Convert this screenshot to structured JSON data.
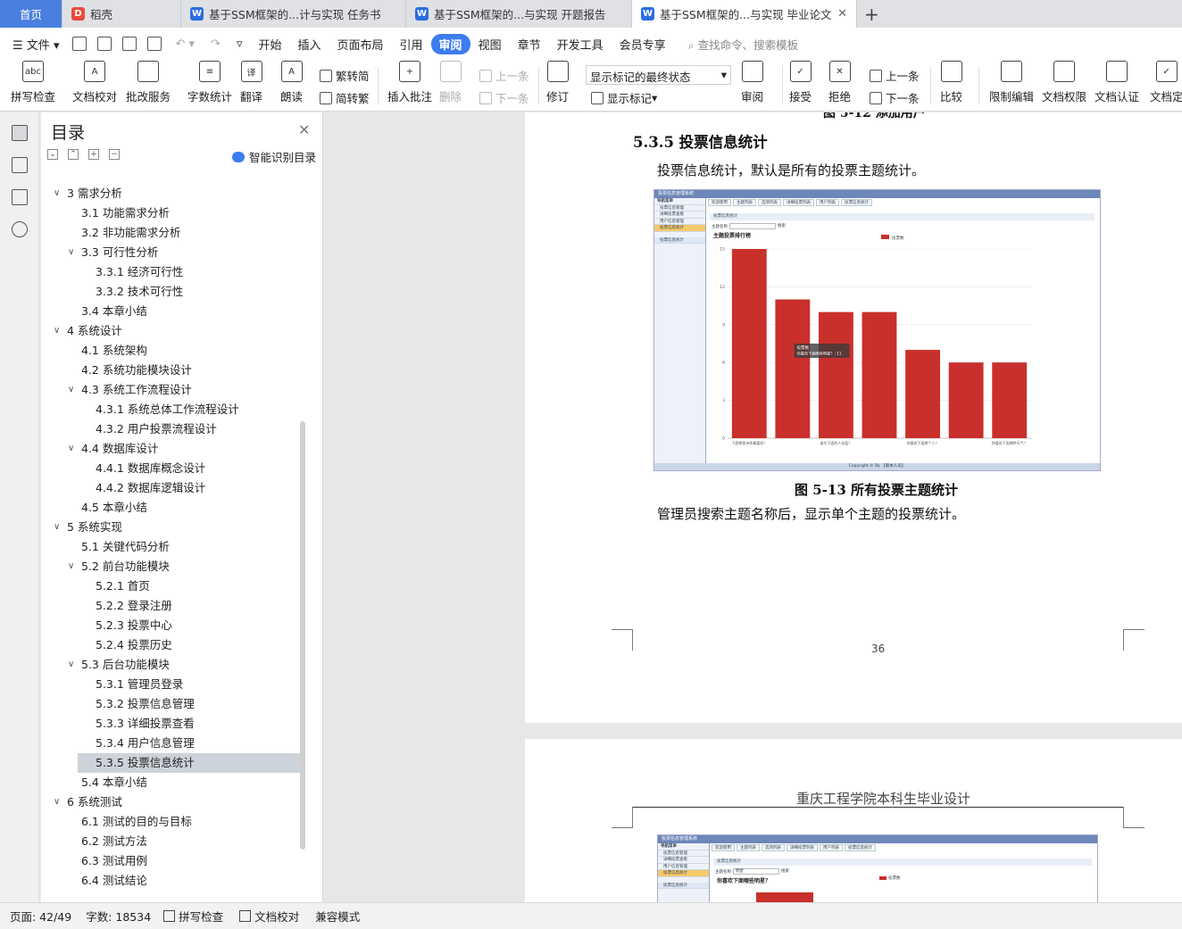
{
  "tabs": {
    "home": "首页",
    "daoke": "稻壳",
    "doc1": "基于SSM框架的...计与实现 任务书",
    "doc2": "基于SSM框架的...与实现 开题报告",
    "doc3": "基于SSM框架的...与实现 毕业论文"
  },
  "menu": {
    "file": "文件",
    "items": [
      "开始",
      "插入",
      "页面布局",
      "引用",
      "审阅",
      "视图",
      "章节",
      "开发工具",
      "会员专享"
    ],
    "search": "查找命令、搜索模板"
  },
  "ribbon": {
    "spell": "拼写检查",
    "proof": "文档校对",
    "annotate": "批改服务",
    "wordcount": "字数统计",
    "translate": "翻译",
    "read": "朗读",
    "trad": "繁转简",
    "simp": "简转繁",
    "insert_comment": "插入批注",
    "delete": "删除",
    "prev": "上一条",
    "next": "下一条",
    "revise": "修订",
    "markup_state": "显示标记的最终状态",
    "show_markup": "显示标记",
    "review": "审阅",
    "accept": "接受",
    "reject": "拒绝",
    "prev2": "上一条",
    "next2": "下一条",
    "compare": "比较",
    "restrict": "限制编辑",
    "rights": "文档权限",
    "certify": "文档认证",
    "final": "文档定"
  },
  "toc": {
    "title": "目录",
    "smart": "智能识别目录",
    "items": [
      {
        "label": "3  需求分析",
        "level": 1,
        "open": true
      },
      {
        "label": "3.1  功能需求分析",
        "level": 2
      },
      {
        "label": "3.2  非功能需求分析",
        "level": 2
      },
      {
        "label": "3.3  可行性分析",
        "level": 2,
        "open": true
      },
      {
        "label": "3.3.1  经济可行性",
        "level": 3
      },
      {
        "label": "3.3.2  技术可行性",
        "level": 3
      },
      {
        "label": "3.4  本章小结",
        "level": 2
      },
      {
        "label": "4  系统设计",
        "level": 1,
        "open": true
      },
      {
        "label": "4.1  系统架构",
        "level": 2
      },
      {
        "label": "4.2  系统功能模块设计",
        "level": 2
      },
      {
        "label": "4.3  系统工作流程设计",
        "level": 2,
        "open": true
      },
      {
        "label": "4.3.1  系统总体工作流程设计",
        "level": 3
      },
      {
        "label": "4.3.2  用户投票流程设计",
        "level": 3
      },
      {
        "label": "4.4  数据库设计",
        "level": 2,
        "open": true
      },
      {
        "label": "4.4.1  数据库概念设计",
        "level": 3
      },
      {
        "label": "4.4.2  数据库逻辑设计",
        "level": 3
      },
      {
        "label": "4.5  本章小结",
        "level": 2
      },
      {
        "label": "5  系统实现",
        "level": 1,
        "open": true
      },
      {
        "label": "5.1  关键代码分析",
        "level": 2
      },
      {
        "label": "5.2  前台功能模块",
        "level": 2,
        "open": true
      },
      {
        "label": "5.2.1  首页",
        "level": 3
      },
      {
        "label": "5.2.2  登录注册",
        "level": 3
      },
      {
        "label": "5.2.3  投票中心",
        "level": 3
      },
      {
        "label": "5.2.4  投票历史",
        "level": 3
      },
      {
        "label": "5.3  后台功能模块",
        "level": 2,
        "open": true
      },
      {
        "label": "5.3.1  管理员登录",
        "level": 3
      },
      {
        "label": "5.3.2  投票信息管理",
        "level": 3
      },
      {
        "label": "5.3.3  详细投票查看",
        "level": 3
      },
      {
        "label": "5.3.4  用户信息管理",
        "level": 3
      },
      {
        "label": "5.3.5  投票信息统计",
        "level": 3,
        "selected": true
      },
      {
        "label": "5.4  本章小结",
        "level": 2
      },
      {
        "label": "6  系统测试",
        "level": 1,
        "open": true
      },
      {
        "label": "6.1  测试的目的与目标",
        "level": 2
      },
      {
        "label": "6.2  测试方法",
        "level": 2
      },
      {
        "label": "6.3  测试用例",
        "level": 2
      },
      {
        "label": "6.4  测试结论",
        "level": 2
      }
    ]
  },
  "doc": {
    "prev_caption": "图 5-12  添加用户",
    "heading": "5.3.5  投票信息统计",
    "para1": "投票信息统计，默认是所有的投票主题统计。",
    "caption": "图 5-13  所有投票主题统计",
    "para2": "管理员搜索主题名称后，显示单个主题的投票统计。",
    "page_number": "36",
    "page2_header": "重庆工程学院本科生毕业设计"
  },
  "shot": {
    "app_title": "投票信息管理系统",
    "side_title": "导航菜单",
    "side_items": [
      "投票信息管理",
      "详细投票查看",
      "用户信息管理",
      "投票信息统计"
    ],
    "tabs": [
      "欢迎使用",
      "主题列表",
      "选项列表",
      "详细投票列表",
      "用户列表",
      "投票信息统计"
    ],
    "panel_title": "投票信息统计",
    "search_label": "主题名称：",
    "search_btn": "搜索",
    "chart_title": "主题投票排行榜",
    "legend": "投票数",
    "footer": "Copyright © By 【版本人员】",
    "tooltip_title": "投票数",
    "tooltip_val": "你喜欢下面哪些明星？: 11",
    "page2_title": "你喜欢下面哪些明星？",
    "page2_input": "明星"
  },
  "chart_data": {
    "type": "bar",
    "title": "主题投票排行榜",
    "categories": [
      "下面哪首诗你最喜欢？",
      "你喜欢下面哪些明星？",
      "哪位才下面的人抗疫？",
      "下面哪部影片最好看？",
      "你喜欢下面哪个人？",
      "下面哪首歌好听？",
      "你喜欢下面哪种天气？"
    ],
    "tick_labels": [
      "下面哪首诗你最喜欢？",
      "",
      "谁为下面的人抗疫？",
      "",
      "你喜欢下面哪个人？",
      "",
      "你喜欢下面哪种天气？"
    ],
    "series": [
      {
        "name": "投票数",
        "values": [
          15,
          11,
          10,
          10,
          7,
          6,
          6
        ]
      }
    ],
    "ylim": [
      0,
      15
    ],
    "yticks": [
      0,
      3,
      6,
      9,
      12,
      15
    ],
    "color": "#c9302c"
  },
  "status": {
    "page": "页面: 42/49",
    "words": "字数: 18534",
    "spell": "拼写检查",
    "proof": "文档校对",
    "mode": "兼容模式"
  }
}
